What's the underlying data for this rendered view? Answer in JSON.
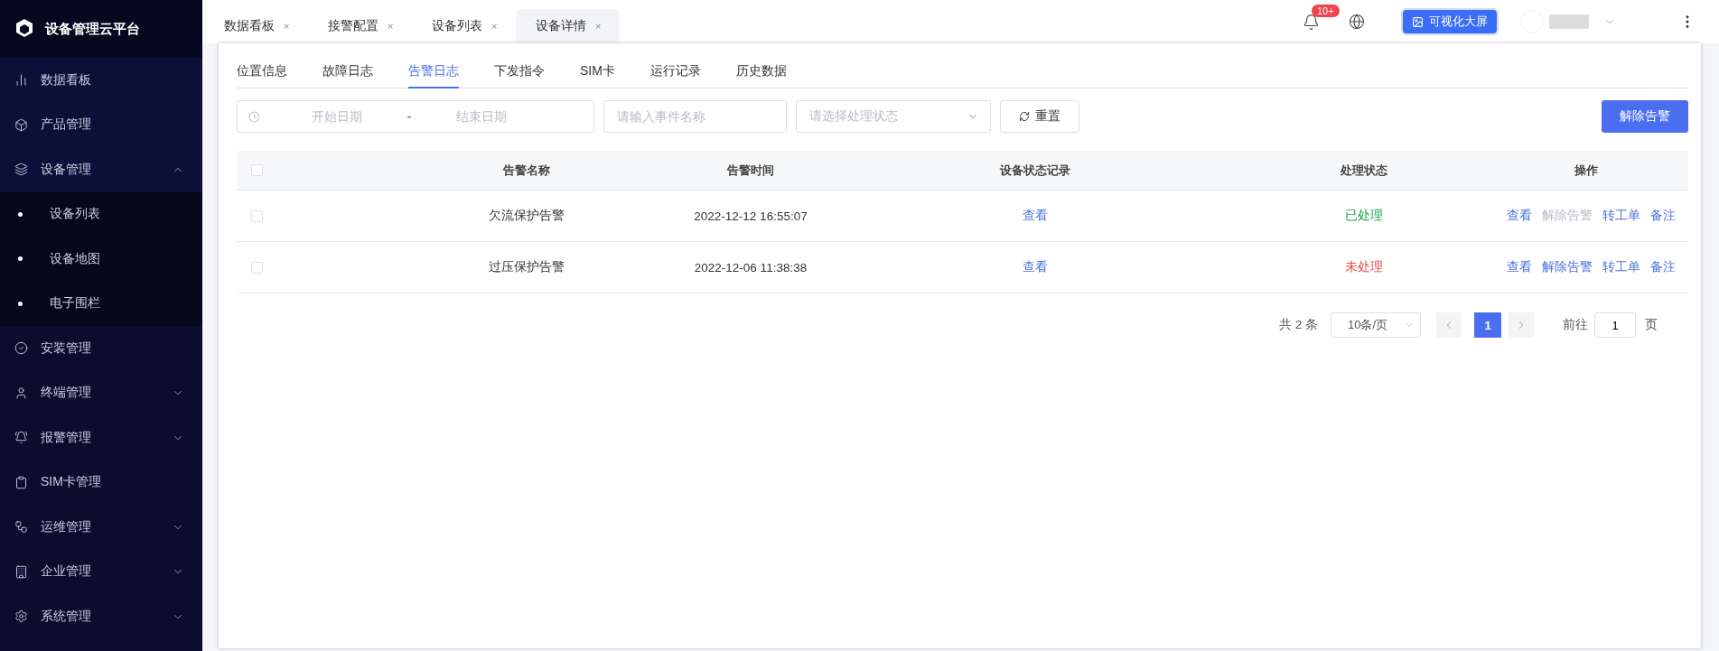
{
  "sidebar": {
    "title": "设备管理云平台",
    "items": [
      {
        "label": "数据看板",
        "expandable": false
      },
      {
        "label": "产品管理",
        "expandable": false
      },
      {
        "label": "设备管理",
        "expandable": true,
        "expanded": true,
        "children": [
          {
            "label": "设备列表"
          },
          {
            "label": "设备地图"
          },
          {
            "label": "电子围栏"
          }
        ]
      },
      {
        "label": "安装管理",
        "expandable": false
      },
      {
        "label": "终端管理",
        "expandable": true,
        "expanded": false
      },
      {
        "label": "报警管理",
        "expandable": true,
        "expanded": false
      },
      {
        "label": "SIM卡管理",
        "expandable": false
      },
      {
        "label": "运维管理",
        "expandable": true,
        "expanded": false
      },
      {
        "label": "企业管理",
        "expandable": true,
        "expanded": false
      },
      {
        "label": "系统管理",
        "expandable": true,
        "expanded": false
      }
    ]
  },
  "page_tabs": [
    {
      "label": "数据看板",
      "close": "×",
      "selected": false
    },
    {
      "label": "接警配置",
      "close": "×",
      "selected": false
    },
    {
      "label": "设备列表",
      "close": "×",
      "selected": false
    },
    {
      "label": "设备详情",
      "close": "×",
      "selected": true
    }
  ],
  "header": {
    "badge": "10+",
    "screen_button": "可视化大屏"
  },
  "detail_tabs": [
    {
      "label": "位置信息",
      "selected": false
    },
    {
      "label": "故障日志",
      "selected": false
    },
    {
      "label": "告警日志",
      "selected": true
    },
    {
      "label": "下发指令",
      "selected": false
    },
    {
      "label": "SIM卡",
      "selected": false
    },
    {
      "label": "运行记录",
      "selected": false
    },
    {
      "label": "历史数据",
      "selected": false
    }
  ],
  "filters": {
    "start_placeholder": "开始日期",
    "separator": "-",
    "end_placeholder": "结束日期",
    "name_placeholder": "请输入事件名称",
    "status_placeholder": "请选择处理状态",
    "reset": "重置",
    "clear_button": "解除告警"
  },
  "table": {
    "select_all_checked": false,
    "columns": [
      "告警名称",
      "告警时间",
      "设备状态记录",
      "处理状态",
      "操作"
    ],
    "rows": [
      {
        "checked": false,
        "name": "欠流保护告警",
        "time": "2022-12-12 16:55:07",
        "record": "查看",
        "status": {
          "text": "已处理",
          "color": "#17a34a"
        },
        "actions": [
          {
            "label": "查看",
            "disabled": false
          },
          {
            "label": "解除告警",
            "disabled": true
          },
          {
            "label": "转工单",
            "disabled": false
          },
          {
            "label": "备注",
            "disabled": false
          }
        ]
      },
      {
        "checked": false,
        "name": "过压保护告警",
        "time": "2022-12-06 11:38:38",
        "record": "查看",
        "status": {
          "text": "未处理",
          "color": "#e5484d"
        },
        "actions": [
          {
            "label": "查看",
            "disabled": false
          },
          {
            "label": "解除告警",
            "disabled": false
          },
          {
            "label": "转工单",
            "disabled": false
          },
          {
            "label": "备注",
            "disabled": false
          }
        ]
      }
    ]
  },
  "pagination": {
    "total": "共 2 条",
    "page_size": "10条/页",
    "pages": [
      {
        "label": "1",
        "selected": true
      }
    ],
    "goto": "前往",
    "goto_value": "1",
    "page_unit": "页"
  }
}
